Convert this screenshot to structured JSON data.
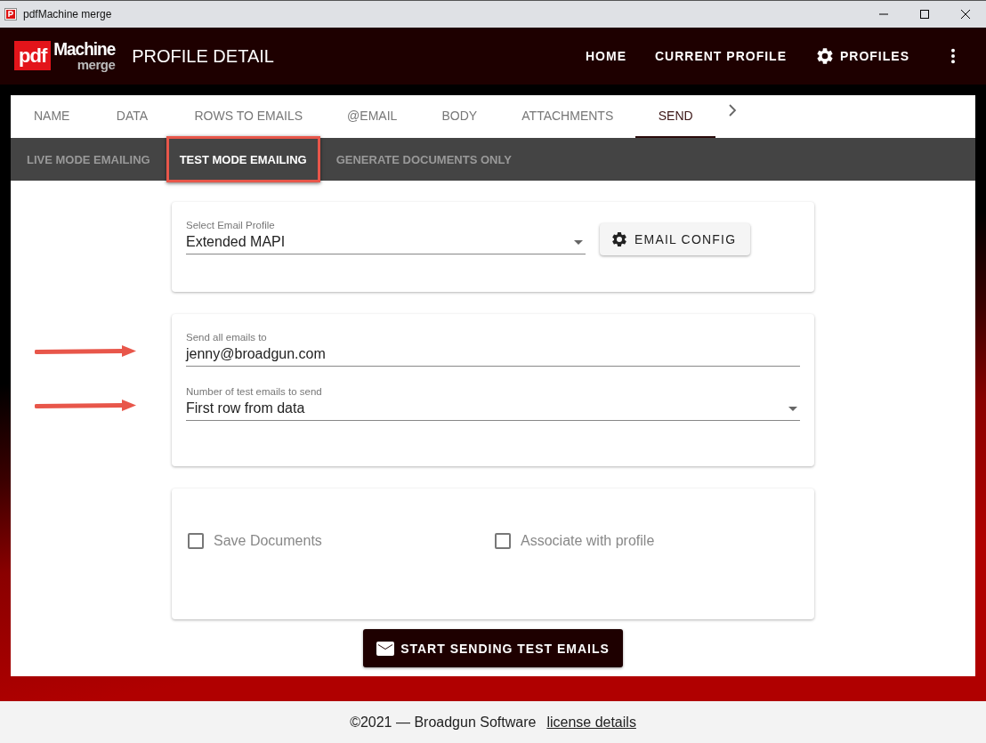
{
  "window": {
    "title": "pdfMachine merge"
  },
  "logo": {
    "pdf": "pdf",
    "machine": "Machine",
    "merge": "merge"
  },
  "header": {
    "title": "PROFILE DETAIL",
    "nav": [
      {
        "label": "HOME",
        "kind": "text"
      },
      {
        "label": "CURRENT PROFILE",
        "kind": "text"
      },
      {
        "label": "PROFILES",
        "kind": "gear"
      }
    ]
  },
  "tabs": [
    {
      "label": "NAME",
      "selected": false
    },
    {
      "label": "DATA",
      "selected": false
    },
    {
      "label": "ROWS TO EMAILS",
      "selected": false
    },
    {
      "label": "@EMAIL",
      "selected": false
    },
    {
      "label": "BODY",
      "selected": false
    },
    {
      "label": "ATTACHMENTS",
      "selected": false
    },
    {
      "label": "SEND",
      "selected": true
    }
  ],
  "subtabs": [
    {
      "label": "LIVE MODE EMAILING",
      "selected": false,
      "highlighted": false
    },
    {
      "label": "TEST MODE EMAILING",
      "selected": true,
      "highlighted": true
    },
    {
      "label": "GENERATE DOCUMENTS ONLY",
      "selected": false,
      "highlighted": false
    }
  ],
  "email_profile": {
    "label": "Select Email Profile",
    "value": "Extended MAPI",
    "button": "EMAIL CONFIG"
  },
  "test_fields": [
    {
      "label": "Send all emails to",
      "value": "jenny@broadgun.com",
      "kind": "text",
      "arrow": true
    },
    {
      "label": "Number of test emails to send",
      "value": "First row from data",
      "kind": "select",
      "arrow": true
    }
  ],
  "options": [
    {
      "label": "Save Documents",
      "checked": false,
      "disabled": true
    },
    {
      "label": "Associate with profile",
      "checked": false,
      "disabled": true
    }
  ],
  "send_button": "START SENDING TEST EMAILS",
  "footer": {
    "text": "©2021 — Broadgun Software",
    "link": "license details"
  }
}
